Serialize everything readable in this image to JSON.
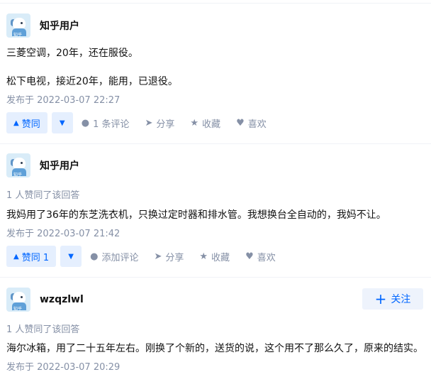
{
  "answers": [
    {
      "author": "知乎用户",
      "avatar": "avatar-image",
      "agree_note": "",
      "content": [
        "三菱空调，20年，还在服役。",
        "松下电视，接近20年，能用，已退役。"
      ],
      "date": "发布于 2022-03-07 22:27",
      "vote_label": "赞同",
      "comment_label": "1 条评论",
      "share_label": "分享",
      "collect_label": "收藏",
      "like_label": "喜欢"
    },
    {
      "author": "知乎用户",
      "avatar": "avatar-image",
      "agree_note": "1 人赞同了该回答",
      "content": [
        "我妈用了36年的东芝洗衣机，只换过定时器和排水管。我想换台全自动的，我妈不让。"
      ],
      "date": "发布于 2022-03-07 21:42",
      "vote_label": "赞同 1",
      "comment_label": "添加评论",
      "share_label": "分享",
      "collect_label": "收藏",
      "like_label": "喜欢"
    },
    {
      "author": "wzqzlwl",
      "avatar": "avatar-image",
      "follow_label": "关注",
      "agree_note": "1 人赞同了该回答",
      "content": [
        "海尔冰箱，用了二十五年左右。刚换了个新的，送货的说，这个用不了那么久了，原来的结实。"
      ],
      "date": "发布于 2022-03-07 20:29"
    }
  ],
  "icons": {
    "vote_up": "▲",
    "vote_down": "▼",
    "comment": "●",
    "share": "➤",
    "collect": "★",
    "like": "♥",
    "follow": "+"
  },
  "colors": {
    "brand_blue": "#0066ff",
    "button_bg": "#e5effe",
    "meta_gray": "#8590a6"
  }
}
